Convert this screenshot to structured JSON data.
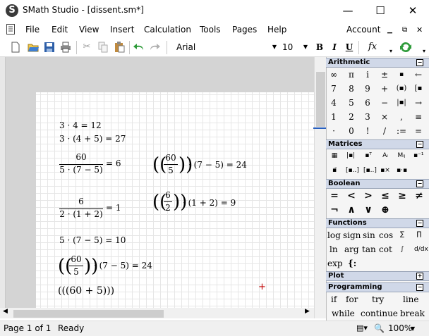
{
  "window": {
    "title": "SMath Studio - [dissent.sm*]",
    "app_icon_letter": "S",
    "minimize": "—",
    "maximize": "☐",
    "close": "✕"
  },
  "menu": {
    "items": [
      "File",
      "Edit",
      "View",
      "Insert",
      "Calculation",
      "Tools",
      "Pages",
      "Help"
    ],
    "account": "Account"
  },
  "toolbar": {
    "font": "Arial",
    "size": "10",
    "bold": "B",
    "italic": "I",
    "underline": "U",
    "fx": "fx"
  },
  "document": {
    "line1": "3 · 4 = 12",
    "line2": "3 · (4 + 5) = 27",
    "f1_num": "60",
    "f1_den": "5 · (7 − 5)",
    "f1_res": "= 6",
    "f2_num": "60",
    "f2_den": "5",
    "f2_tail": "· (7 − 5) = 24",
    "f3_num": "6",
    "f3_den": "2 · (1 + 2)",
    "f3_res": "= 1",
    "f4_num": "6",
    "f4_den": "2",
    "f4_tail": "· (1 + 2) = 9",
    "line5": "5 · (7 − 5) = 10",
    "f5_num": "60",
    "f5_den": "5",
    "f5_tail": "· (7 − 5) = 24",
    "line7": "(((60 + 5)))",
    "cursor": "+"
  },
  "status": {
    "page": "Page 1 of 1",
    "state": "Ready",
    "zoom": "100%"
  },
  "panels": {
    "arithmetic": {
      "title": "Arithmetic",
      "rows": [
        [
          "∞",
          "π",
          "i",
          "±",
          "▪",
          "←"
        ],
        [
          "7",
          "8",
          "9",
          "+",
          "(▪)",
          "[▪"
        ],
        [
          "4",
          "5",
          "6",
          "−",
          "|▪|",
          "→"
        ],
        [
          "1",
          "2",
          "3",
          "×",
          ",",
          "≡"
        ],
        [
          "·",
          "0",
          "!",
          "/",
          ":=",
          "="
        ]
      ]
    },
    "matrices": {
      "title": "Matrices"
    },
    "boolean": {
      "title": "Boolean",
      "row1": [
        "=",
        "<",
        ">",
        "≤",
        "≥",
        "≠"
      ],
      "row2": [
        "¬",
        "∧",
        "∨",
        "⊕"
      ]
    },
    "functions": {
      "title": "Functions",
      "row1": [
        "log",
        "sign",
        "sin",
        "cos"
      ],
      "row2": [
        "ln",
        "arg",
        "tan",
        "cot"
      ],
      "row3": [
        "exp",
        "{:"
      ]
    },
    "plot": {
      "title": "Plot"
    },
    "programming": {
      "title": "Programming",
      "row1": [
        "if",
        "for",
        "try",
        "line"
      ],
      "row2": [
        "while",
        "continue",
        "break"
      ]
    }
  }
}
